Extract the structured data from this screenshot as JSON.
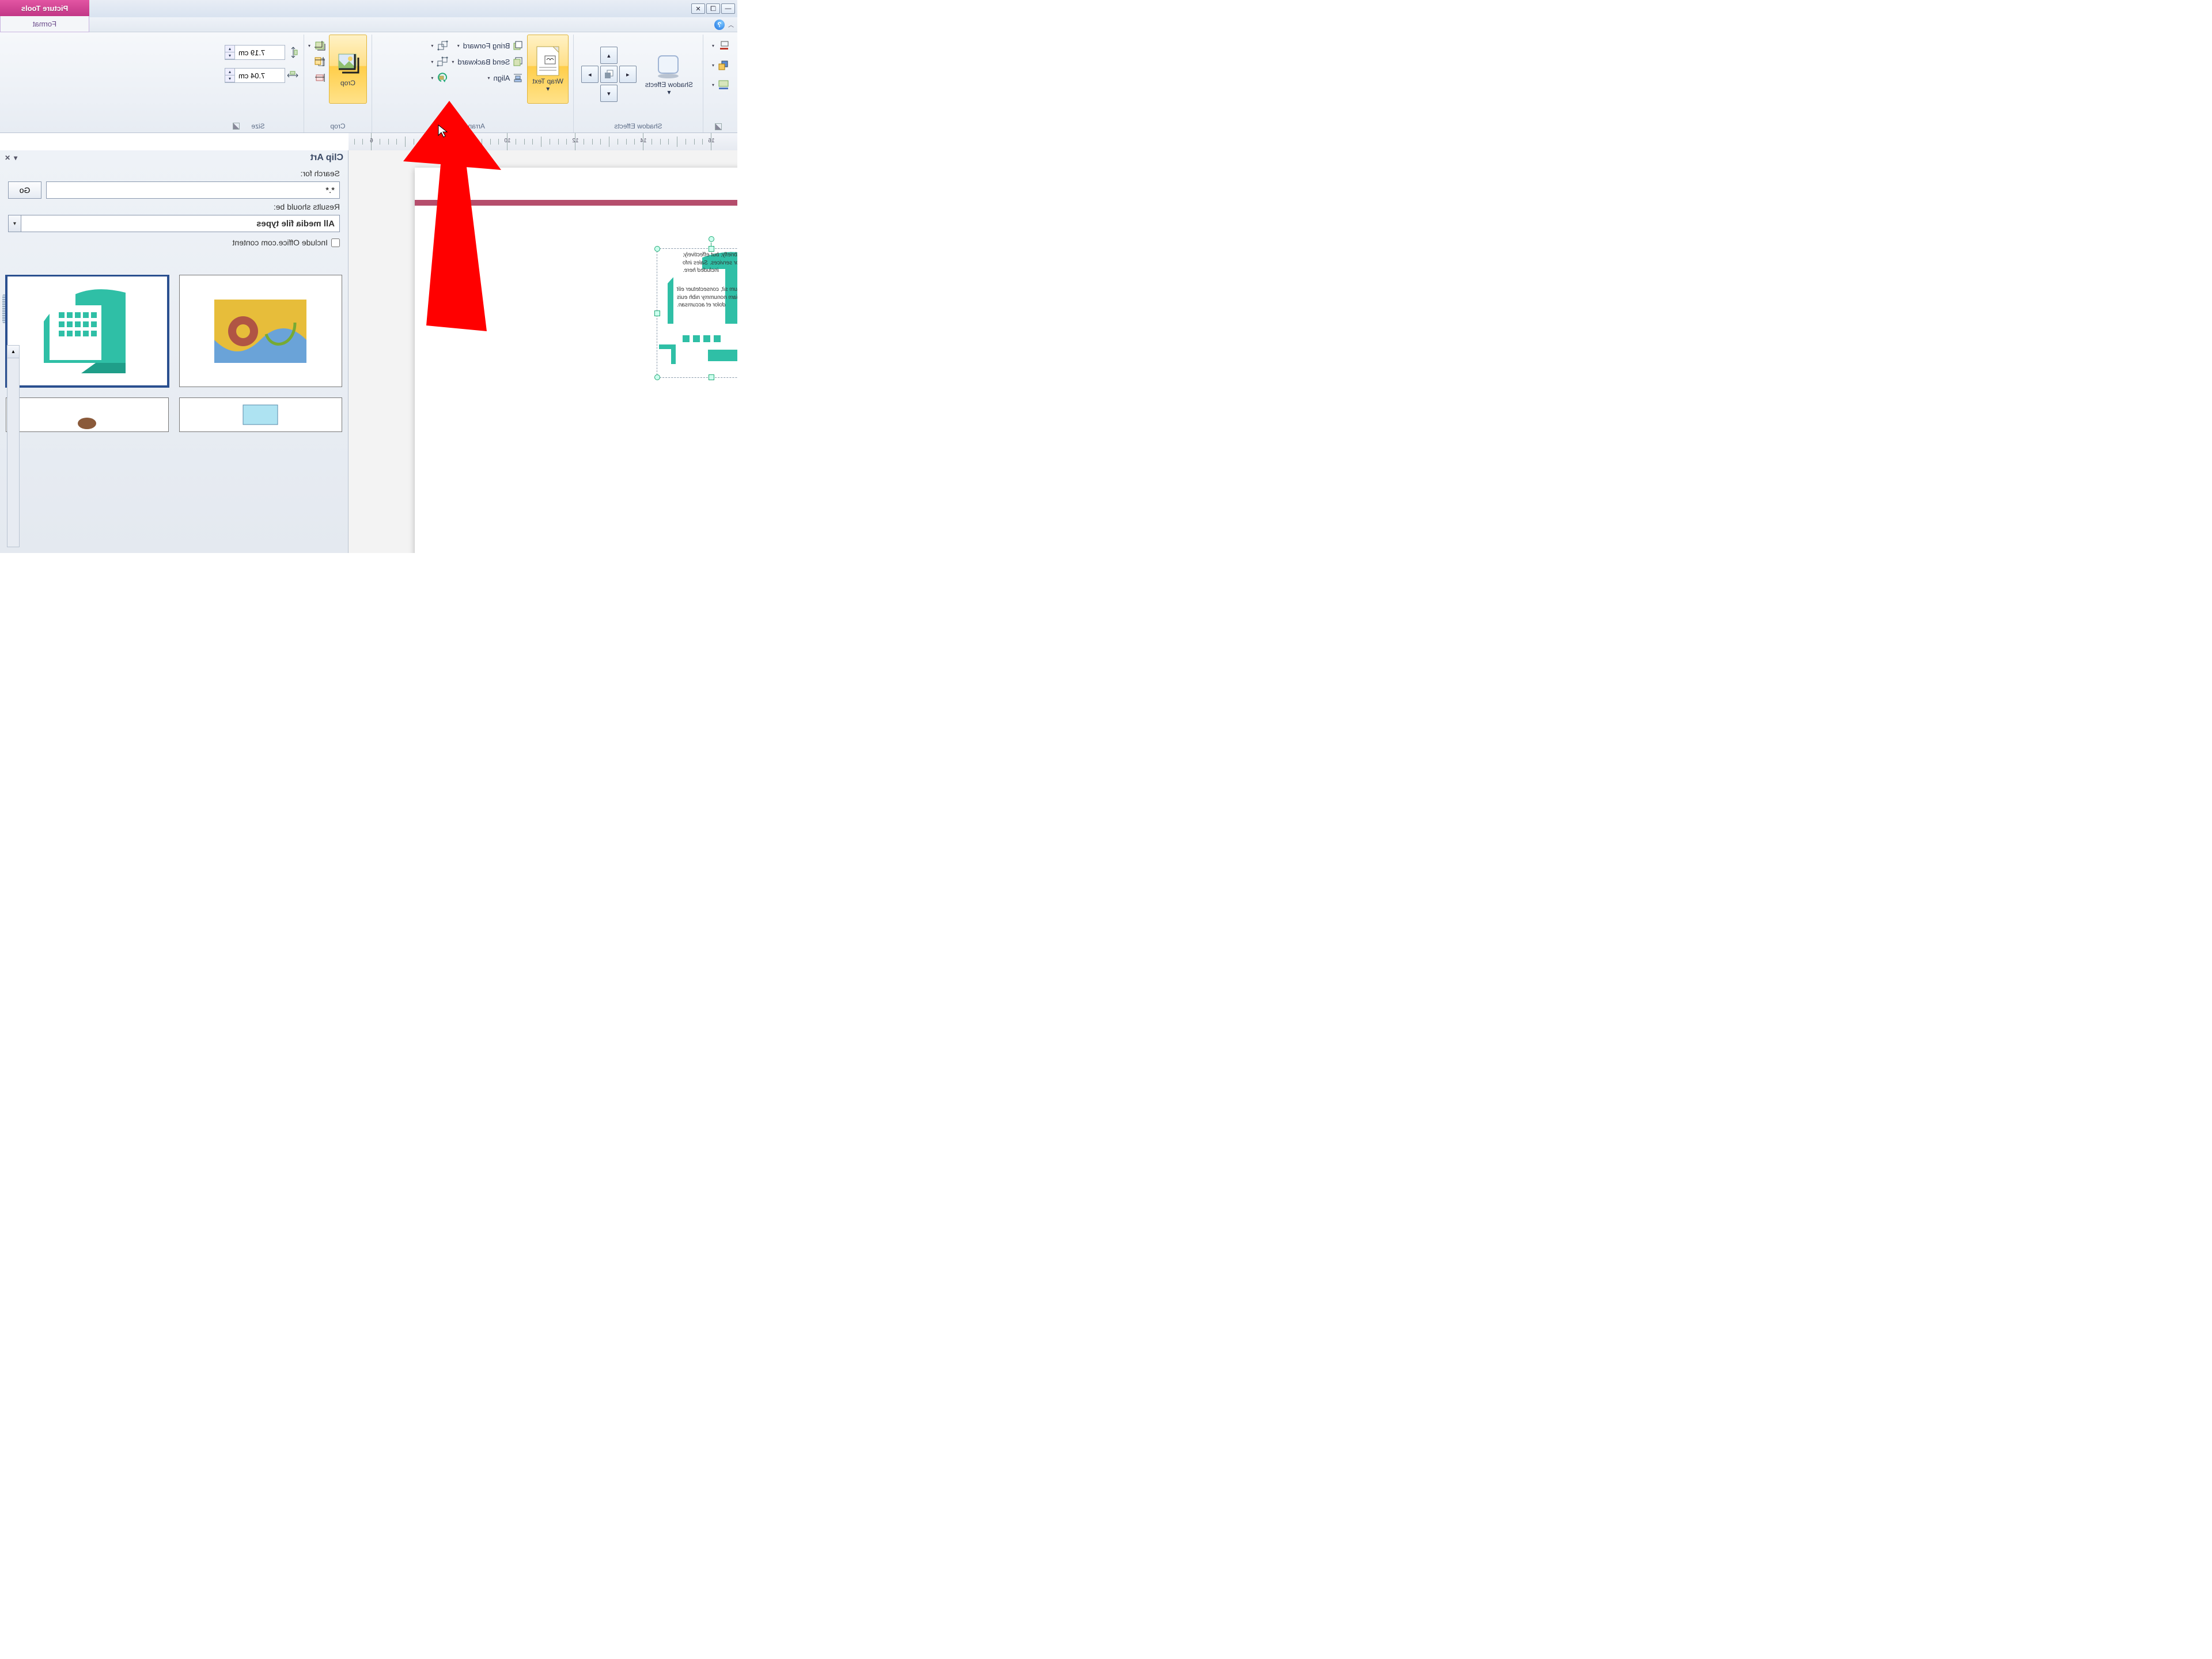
{
  "contextual_tab": {
    "title": "Picture Tools",
    "sub": "Format"
  },
  "ribbon": {
    "shadow_effects": {
      "label": "Shadow Effects",
      "button": "Shadow Effects"
    },
    "arrange": {
      "label": "Arrange",
      "wrap_text": "Wrap Text",
      "bring_forward": "Bring Forward",
      "send_backward": "Send Backward",
      "align": "Align"
    },
    "crop": {
      "label": "Crop",
      "button": "Crop"
    },
    "size": {
      "label": "Size",
      "height": "7.19 cm",
      "width": "7.04 cm"
    }
  },
  "ruler_marks": [
    "6",
    "8",
    "10",
    "12",
    "14",
    "16"
  ],
  "clipart": {
    "title": "Clip Art",
    "search_label": "Search for:",
    "search_value": "*.*",
    "go": "Go",
    "results_label": "Results should be:",
    "media_type": "All media file types",
    "include_office": "Include Office.com content"
  },
  "doc_text": {
    "p1": "List briefly, but effectively, products or services. Sales info included here.",
    "p2": "Lorem ipsum sit, consectetuer elit sed diam nonummy nibh euis dolor et accumsan."
  }
}
